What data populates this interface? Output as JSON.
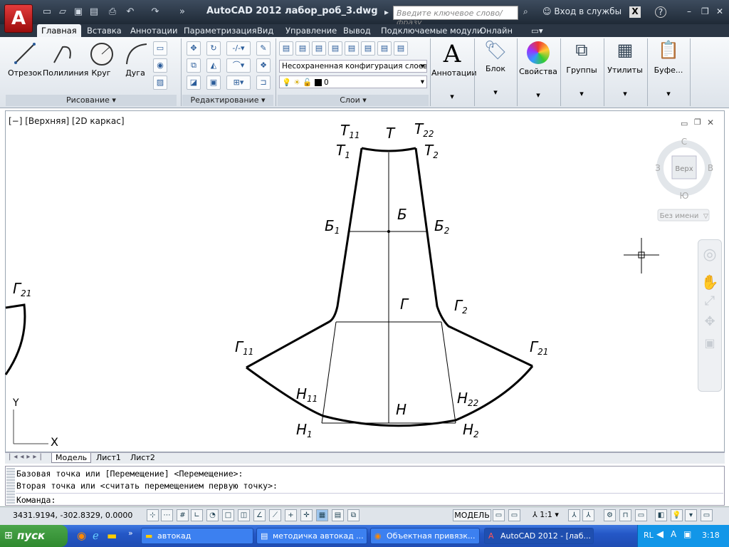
{
  "title": {
    "app_logo": "A",
    "text": "AutoCAD 2012    лабор_роб_3.dwg",
    "search_placeholder": "Введите ключевое слово/фразу",
    "login": "Вход в службы",
    "help": "?",
    "quick_access_icons": [
      "new-icon",
      "open-icon",
      "save-icon",
      "saveas-icon",
      "print-icon",
      "undo-icon",
      "redo-icon"
    ],
    "window_buttons": {
      "minimize": "–",
      "restore": "❐",
      "close": "✕"
    }
  },
  "ribbon_tabs": [
    "Главная",
    "Вставка",
    "Аннотации",
    "Параметризация",
    "Вид",
    "Управление",
    "Вывод",
    "Подключаемые модули",
    "Онлайн"
  ],
  "ribbon": {
    "draw": {
      "title": "Рисование",
      "buttons": [
        "Отрезок",
        "Полилиния",
        "Круг",
        "Дуга"
      ]
    },
    "modify": {
      "title": "Редактирование"
    },
    "layers": {
      "title": "Слои",
      "layer_state": "Несохраненная конфигурация слоев",
      "current_layer": "0"
    },
    "large_buttons": [
      "Аннотации",
      "Блок",
      "Свойства",
      "Группы",
      "Утилиты",
      "Буфе..."
    ]
  },
  "viewport": {
    "label": "[−] [Верхняя] [2D каркас]",
    "viewcube": {
      "north": "С",
      "south": "Ю",
      "west": "З",
      "east": "В",
      "face": "Верх",
      "ucs": "Без имени"
    },
    "ucs_axes": {
      "x": "X",
      "y": "Y"
    }
  },
  "drawing_labels": {
    "T11": "Т",
    "T11s": "11",
    "T": "Т",
    "T22": "Т",
    "T22s": "22",
    "T1": "Т",
    "T1s": "1",
    "T2": "Т",
    "T2s": "2",
    "B1": "Б",
    "B1s": "1",
    "B": "Б",
    "B2": "Б",
    "B2s": "2",
    "G": "Г",
    "G2": "Г",
    "G2s": "2",
    "G11": "Г",
    "G11s": "11",
    "G21": "Г",
    "G21s": "21",
    "G21L": "Г",
    "G21Ls": "21",
    "H11": "Н",
    "H11s": "11",
    "H": "Н",
    "H22": "Н",
    "H22s": "22",
    "H1": "Н",
    "H1s": "1",
    "H2": "Н",
    "H2s": "2"
  },
  "layout_tabs": [
    "Модель",
    "Лист1",
    "Лист2"
  ],
  "command": {
    "line1": "Базовая точка или [Перемещение] <Перемещение>:",
    "line2": "Вторая точка или <считать перемещением первую точку>:",
    "prompt": "Команда:"
  },
  "status": {
    "coords": "3431.9194, -302.8329, 0.0000",
    "model": "МОДЕЛЬ",
    "scale": "1:1"
  },
  "taskbar": {
    "start": "пуск",
    "tasks": [
      "автокад",
      "методичка автокад ...",
      "Объектная привязк...",
      "AutoCAD 2012 - [лаб..."
    ],
    "lang": "RL",
    "time": "3:18"
  }
}
